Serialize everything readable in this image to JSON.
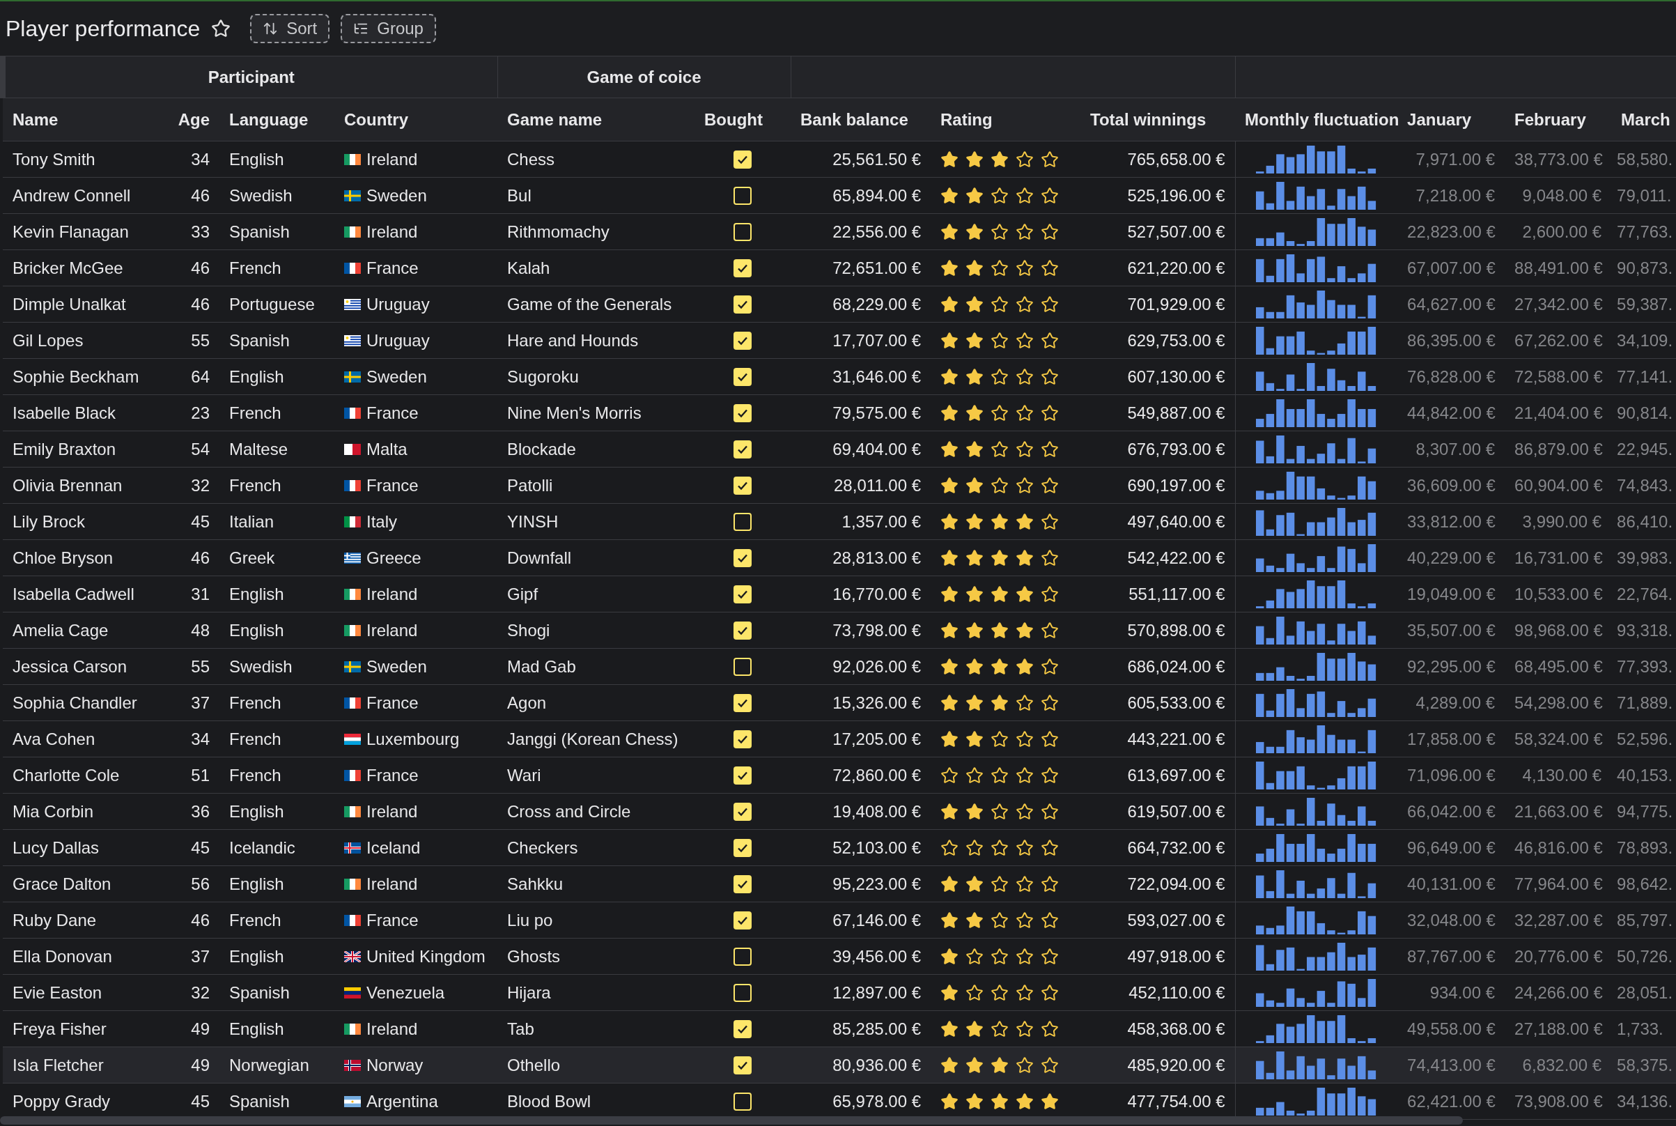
{
  "title": "Player performance",
  "favorite": false,
  "toolbar": [
    {
      "kind": "sort",
      "label": "Sort"
    },
    {
      "kind": "group",
      "label": "Group"
    }
  ],
  "column_groups": [
    {
      "label": "Participant"
    },
    {
      "label": "Game of coice"
    }
  ],
  "columns": [
    "Name",
    "Age",
    "Language",
    "Country",
    "Game name",
    "Bought",
    "Bank balance",
    "Rating",
    "Total winnings",
    "Monthly fluctuation",
    "January",
    "February",
    "March"
  ],
  "rows": [
    {
      "name": "Tony Smith",
      "age": "34",
      "language": "English",
      "country": "Ireland",
      "flag": {
        "kind": "ireland"
      },
      "game": "Chess",
      "bought": true,
      "bank": "25,561.50 €",
      "stars": 3,
      "total": "765,658.00 €",
      "january": "7,971.00 €",
      "february": "38,773.00 €",
      "march": "58,580.",
      "selected": false
    },
    {
      "name": "Andrew Connell",
      "age": "46",
      "language": "Swedish",
      "country": "Sweden",
      "flag": {
        "kind": "sweden"
      },
      "game": "Bul",
      "bought": false,
      "bank": "65,894.00 €",
      "stars": 2,
      "total": "525,196.00 €",
      "january": "7,218.00 €",
      "february": "9,048.00 €",
      "march": "79,011.",
      "selected": false
    },
    {
      "name": "Kevin Flanagan",
      "age": "33",
      "language": "Spanish",
      "country": "Ireland",
      "flag": {
        "kind": "ireland"
      },
      "game": "Rithmomachy",
      "bought": false,
      "bank": "22,556.00 €",
      "stars": 2,
      "total": "527,507.00 €",
      "january": "22,823.00 €",
      "february": "2,600.00 €",
      "march": "77,763.",
      "selected": false
    },
    {
      "name": "Bricker McGee",
      "age": "46",
      "language": "French",
      "country": "France",
      "flag": {
        "kind": "france"
      },
      "game": "Kalah",
      "bought": true,
      "bank": "72,651.00 €",
      "stars": 2,
      "total": "621,220.00 €",
      "january": "67,007.00 €",
      "february": "88,491.00 €",
      "march": "90,873.",
      "selected": false
    },
    {
      "name": "Dimple Unalkat",
      "age": "46",
      "language": "Portuguese",
      "country": "Uruguay",
      "flag": {
        "kind": "uruguay"
      },
      "game": "Game of the Generals",
      "bought": true,
      "bank": "68,229.00 €",
      "stars": 2,
      "total": "701,929.00 €",
      "january": "64,627.00 €",
      "february": "27,342.00 €",
      "march": "59,387.",
      "selected": false
    },
    {
      "name": "Gil Lopes",
      "age": "55",
      "language": "Spanish",
      "country": "Uruguay",
      "flag": {
        "kind": "uruguay"
      },
      "game": "Hare and Hounds",
      "bought": true,
      "bank": "17,707.00 €",
      "stars": 2,
      "total": "629,753.00 €",
      "january": "86,395.00 €",
      "february": "67,262.00 €",
      "march": "34,109.",
      "selected": false
    },
    {
      "name": "Sophie Beckham",
      "age": "64",
      "language": "English",
      "country": "Sweden",
      "flag": {
        "kind": "sweden"
      },
      "game": "Sugoroku",
      "bought": true,
      "bank": "31,646.00 €",
      "stars": 2,
      "total": "607,130.00 €",
      "january": "76,828.00 €",
      "february": "72,588.00 €",
      "march": "77,141.",
      "selected": false
    },
    {
      "name": "Isabelle Black",
      "age": "23",
      "language": "French",
      "country": "France",
      "flag": {
        "kind": "france"
      },
      "game": "Nine Men's Morris",
      "bought": true,
      "bank": "79,575.00 €",
      "stars": 2,
      "total": "549,887.00 €",
      "january": "44,842.00 €",
      "february": "21,404.00 €",
      "march": "90,814.",
      "selected": false
    },
    {
      "name": "Emily Braxton",
      "age": "54",
      "language": "Maltese",
      "country": "Malta",
      "flag": {
        "kind": "malta"
      },
      "game": "Blockade",
      "bought": true,
      "bank": "69,404.00 €",
      "stars": 2,
      "total": "676,793.00 €",
      "january": "8,307.00 €",
      "february": "86,879.00 €",
      "march": "22,945.",
      "selected": false
    },
    {
      "name": "Olivia Brennan",
      "age": "32",
      "language": "French",
      "country": "France",
      "flag": {
        "kind": "france"
      },
      "game": "Patolli",
      "bought": true,
      "bank": "28,011.00 €",
      "stars": 2,
      "total": "690,197.00 €",
      "january": "36,609.00 €",
      "february": "60,904.00 €",
      "march": "74,843.",
      "selected": false
    },
    {
      "name": "Lily Brock",
      "age": "45",
      "language": "Italian",
      "country": "Italy",
      "flag": {
        "kind": "italy"
      },
      "game": "YINSH",
      "bought": false,
      "bank": "1,357.00 €",
      "stars": 4,
      "total": "497,640.00 €",
      "january": "33,812.00 €",
      "february": "3,990.00 €",
      "march": "86,410.",
      "selected": false
    },
    {
      "name": "Chloe Bryson",
      "age": "46",
      "language": "Greek",
      "country": "Greece",
      "flag": {
        "kind": "greece"
      },
      "game": "Downfall",
      "bought": true,
      "bank": "28,813.00 €",
      "stars": 4,
      "total": "542,422.00 €",
      "january": "40,229.00 €",
      "february": "16,731.00 €",
      "march": "39,983.",
      "selected": false
    },
    {
      "name": "Isabella Cadwell",
      "age": "31",
      "language": "English",
      "country": "Ireland",
      "flag": {
        "kind": "ireland"
      },
      "game": "Gipf",
      "bought": true,
      "bank": "16,770.00 €",
      "stars": 4,
      "total": "551,117.00 €",
      "january": "19,049.00 €",
      "february": "10,533.00 €",
      "march": "22,764.",
      "selected": false
    },
    {
      "name": "Amelia Cage",
      "age": "48",
      "language": "English",
      "country": "Ireland",
      "flag": {
        "kind": "ireland"
      },
      "game": "Shogi",
      "bought": true,
      "bank": "73,798.00 €",
      "stars": 4,
      "total": "570,898.00 €",
      "january": "35,507.00 €",
      "february": "98,968.00 €",
      "march": "93,318.",
      "selected": false
    },
    {
      "name": "Jessica Carson",
      "age": "55",
      "language": "Swedish",
      "country": "Sweden",
      "flag": {
        "kind": "sweden"
      },
      "game": "Mad Gab",
      "bought": false,
      "bank": "92,026.00 €",
      "stars": 4,
      "total": "686,024.00 €",
      "january": "92,295.00 €",
      "february": "68,495.00 €",
      "march": "77,393.",
      "selected": false
    },
    {
      "name": "Sophia Chandler",
      "age": "37",
      "language": "French",
      "country": "France",
      "flag": {
        "kind": "france"
      },
      "game": "Agon",
      "bought": true,
      "bank": "15,326.00 €",
      "stars": 3,
      "total": "605,533.00 €",
      "january": "4,289.00 €",
      "february": "54,298.00 €",
      "march": "71,889.",
      "selected": false
    },
    {
      "name": "Ava Cohen",
      "age": "34",
      "language": "French",
      "country": "Luxembourg",
      "flag": {
        "kind": "luxembourg"
      },
      "game": "Janggi (Korean Chess)",
      "bought": true,
      "bank": "17,205.00 €",
      "stars": 2,
      "total": "443,221.00 €",
      "january": "17,858.00 €",
      "february": "58,324.00 €",
      "march": "52,596.",
      "selected": false
    },
    {
      "name": "Charlotte Cole",
      "age": "51",
      "language": "French",
      "country": "France",
      "flag": {
        "kind": "france"
      },
      "game": "Wari",
      "bought": true,
      "bank": "72,860.00 €",
      "stars": 0,
      "total": "613,697.00 €",
      "january": "71,096.00 €",
      "february": "4,130.00 €",
      "march": "40,153.",
      "selected": false
    },
    {
      "name": "Mia Corbin",
      "age": "36",
      "language": "English",
      "country": "Ireland",
      "flag": {
        "kind": "ireland"
      },
      "game": "Cross and Circle",
      "bought": true,
      "bank": "19,408.00 €",
      "stars": 2,
      "total": "619,507.00 €",
      "january": "66,042.00 €",
      "february": "21,663.00 €",
      "march": "94,775.",
      "selected": false
    },
    {
      "name": "Lucy Dallas",
      "age": "45",
      "language": "Icelandic",
      "country": "Iceland",
      "flag": {
        "kind": "iceland"
      },
      "game": "Checkers",
      "bought": true,
      "bank": "52,103.00 €",
      "stars": 0,
      "total": "664,732.00 €",
      "january": "96,649.00 €",
      "february": "46,816.00 €",
      "march": "78,893.",
      "selected": false
    },
    {
      "name": "Grace Dalton",
      "age": "56",
      "language": "English",
      "country": "Ireland",
      "flag": {
        "kind": "ireland"
      },
      "game": "Sahkku",
      "bought": true,
      "bank": "95,223.00 €",
      "stars": 2,
      "total": "722,094.00 €",
      "january": "40,131.00 €",
      "february": "77,964.00 €",
      "march": "98,642.",
      "selected": false
    },
    {
      "name": "Ruby Dane",
      "age": "46",
      "language": "French",
      "country": "France",
      "flag": {
        "kind": "france"
      },
      "game": "Liu po",
      "bought": true,
      "bank": "67,146.00 €",
      "stars": 2,
      "total": "593,027.00 €",
      "january": "32,048.00 €",
      "february": "32,287.00 €",
      "march": "85,797.",
      "selected": false
    },
    {
      "name": "Ella Donovan",
      "age": "37",
      "language": "English",
      "country": "United Kingdom",
      "flag": {
        "kind": "uk"
      },
      "game": "Ghosts",
      "bought": false,
      "bank": "39,456.00 €",
      "stars": 1,
      "total": "497,918.00 €",
      "january": "87,767.00 €",
      "february": "20,776.00 €",
      "march": "50,726.",
      "selected": false
    },
    {
      "name": "Evie Easton",
      "age": "32",
      "language": "Spanish",
      "country": "Venezuela",
      "flag": {
        "kind": "venezuela"
      },
      "game": "Hijara",
      "bought": false,
      "bank": "12,897.00 €",
      "stars": 1,
      "total": "452,110.00 €",
      "january": "934.00 €",
      "february": "24,266.00 €",
      "march": "28,051.",
      "selected": false
    },
    {
      "name": "Freya Fisher",
      "age": "49",
      "language": "English",
      "country": "Ireland",
      "flag": {
        "kind": "ireland"
      },
      "game": "Tab",
      "bought": true,
      "bank": "85,285.00 €",
      "stars": 2,
      "total": "458,368.00 €",
      "january": "49,558.00 €",
      "february": "27,188.00 €",
      "march": "1,733.",
      "selected": false
    },
    {
      "name": "Isla Fletcher",
      "age": "49",
      "language": "Norwegian",
      "country": "Norway",
      "flag": {
        "kind": "norway"
      },
      "game": "Othello",
      "bought": true,
      "bank": "80,936.00 €",
      "stars": 3,
      "total": "485,920.00 €",
      "january": "74,413.00 €",
      "february": "6,832.00 €",
      "march": "58,375.",
      "selected": true
    },
    {
      "name": "Poppy Grady",
      "age": "45",
      "language": "Spanish",
      "country": "Argentina",
      "flag": {
        "kind": "argentina"
      },
      "game": "Blood Bowl",
      "bought": false,
      "bank": "65,978.00 €",
      "stars": 5,
      "total": "477,754.00 €",
      "january": "62,421.00 €",
      "february": "73,908.00 €",
      "march": "34,136.",
      "selected": false
    }
  ]
}
